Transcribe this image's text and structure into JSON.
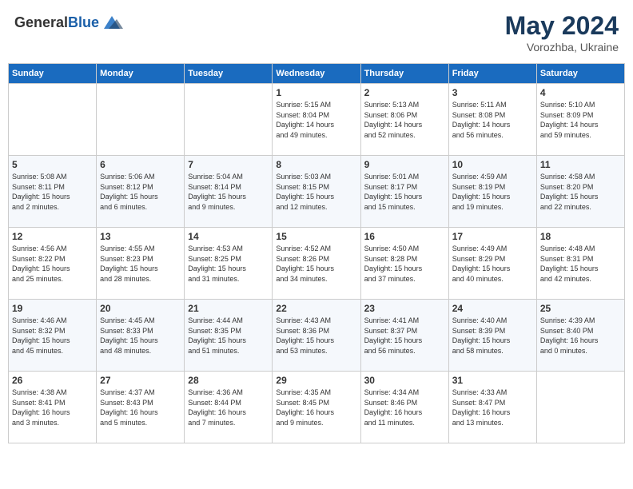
{
  "header": {
    "logo_general": "General",
    "logo_blue": "Blue",
    "title": "May 2024",
    "location": "Vorozhba, Ukraine"
  },
  "days_of_week": [
    "Sunday",
    "Monday",
    "Tuesday",
    "Wednesday",
    "Thursday",
    "Friday",
    "Saturday"
  ],
  "weeks": [
    [
      {
        "day": "",
        "info": ""
      },
      {
        "day": "",
        "info": ""
      },
      {
        "day": "",
        "info": ""
      },
      {
        "day": "1",
        "info": "Sunrise: 5:15 AM\nSunset: 8:04 PM\nDaylight: 14 hours\nand 49 minutes."
      },
      {
        "day": "2",
        "info": "Sunrise: 5:13 AM\nSunset: 8:06 PM\nDaylight: 14 hours\nand 52 minutes."
      },
      {
        "day": "3",
        "info": "Sunrise: 5:11 AM\nSunset: 8:08 PM\nDaylight: 14 hours\nand 56 minutes."
      },
      {
        "day": "4",
        "info": "Sunrise: 5:10 AM\nSunset: 8:09 PM\nDaylight: 14 hours\nand 59 minutes."
      }
    ],
    [
      {
        "day": "5",
        "info": "Sunrise: 5:08 AM\nSunset: 8:11 PM\nDaylight: 15 hours\nand 2 minutes."
      },
      {
        "day": "6",
        "info": "Sunrise: 5:06 AM\nSunset: 8:12 PM\nDaylight: 15 hours\nand 6 minutes."
      },
      {
        "day": "7",
        "info": "Sunrise: 5:04 AM\nSunset: 8:14 PM\nDaylight: 15 hours\nand 9 minutes."
      },
      {
        "day": "8",
        "info": "Sunrise: 5:03 AM\nSunset: 8:15 PM\nDaylight: 15 hours\nand 12 minutes."
      },
      {
        "day": "9",
        "info": "Sunrise: 5:01 AM\nSunset: 8:17 PM\nDaylight: 15 hours\nand 15 minutes."
      },
      {
        "day": "10",
        "info": "Sunrise: 4:59 AM\nSunset: 8:19 PM\nDaylight: 15 hours\nand 19 minutes."
      },
      {
        "day": "11",
        "info": "Sunrise: 4:58 AM\nSunset: 8:20 PM\nDaylight: 15 hours\nand 22 minutes."
      }
    ],
    [
      {
        "day": "12",
        "info": "Sunrise: 4:56 AM\nSunset: 8:22 PM\nDaylight: 15 hours\nand 25 minutes."
      },
      {
        "day": "13",
        "info": "Sunrise: 4:55 AM\nSunset: 8:23 PM\nDaylight: 15 hours\nand 28 minutes."
      },
      {
        "day": "14",
        "info": "Sunrise: 4:53 AM\nSunset: 8:25 PM\nDaylight: 15 hours\nand 31 minutes."
      },
      {
        "day": "15",
        "info": "Sunrise: 4:52 AM\nSunset: 8:26 PM\nDaylight: 15 hours\nand 34 minutes."
      },
      {
        "day": "16",
        "info": "Sunrise: 4:50 AM\nSunset: 8:28 PM\nDaylight: 15 hours\nand 37 minutes."
      },
      {
        "day": "17",
        "info": "Sunrise: 4:49 AM\nSunset: 8:29 PM\nDaylight: 15 hours\nand 40 minutes."
      },
      {
        "day": "18",
        "info": "Sunrise: 4:48 AM\nSunset: 8:31 PM\nDaylight: 15 hours\nand 42 minutes."
      }
    ],
    [
      {
        "day": "19",
        "info": "Sunrise: 4:46 AM\nSunset: 8:32 PM\nDaylight: 15 hours\nand 45 minutes."
      },
      {
        "day": "20",
        "info": "Sunrise: 4:45 AM\nSunset: 8:33 PM\nDaylight: 15 hours\nand 48 minutes."
      },
      {
        "day": "21",
        "info": "Sunrise: 4:44 AM\nSunset: 8:35 PM\nDaylight: 15 hours\nand 51 minutes."
      },
      {
        "day": "22",
        "info": "Sunrise: 4:43 AM\nSunset: 8:36 PM\nDaylight: 15 hours\nand 53 minutes."
      },
      {
        "day": "23",
        "info": "Sunrise: 4:41 AM\nSunset: 8:37 PM\nDaylight: 15 hours\nand 56 minutes."
      },
      {
        "day": "24",
        "info": "Sunrise: 4:40 AM\nSunset: 8:39 PM\nDaylight: 15 hours\nand 58 minutes."
      },
      {
        "day": "25",
        "info": "Sunrise: 4:39 AM\nSunset: 8:40 PM\nDaylight: 16 hours\nand 0 minutes."
      }
    ],
    [
      {
        "day": "26",
        "info": "Sunrise: 4:38 AM\nSunset: 8:41 PM\nDaylight: 16 hours\nand 3 minutes."
      },
      {
        "day": "27",
        "info": "Sunrise: 4:37 AM\nSunset: 8:43 PM\nDaylight: 16 hours\nand 5 minutes."
      },
      {
        "day": "28",
        "info": "Sunrise: 4:36 AM\nSunset: 8:44 PM\nDaylight: 16 hours\nand 7 minutes."
      },
      {
        "day": "29",
        "info": "Sunrise: 4:35 AM\nSunset: 8:45 PM\nDaylight: 16 hours\nand 9 minutes."
      },
      {
        "day": "30",
        "info": "Sunrise: 4:34 AM\nSunset: 8:46 PM\nDaylight: 16 hours\nand 11 minutes."
      },
      {
        "day": "31",
        "info": "Sunrise: 4:33 AM\nSunset: 8:47 PM\nDaylight: 16 hours\nand 13 minutes."
      },
      {
        "day": "",
        "info": ""
      }
    ]
  ]
}
